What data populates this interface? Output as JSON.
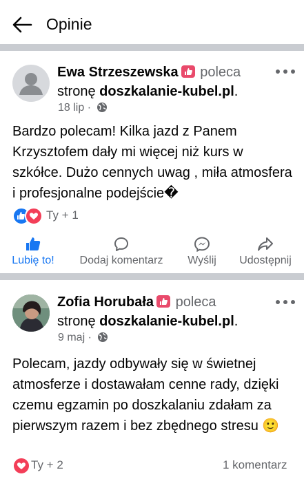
{
  "header": {
    "title": "Opinie"
  },
  "posts": [
    {
      "author": "Ewa Strzeszewska",
      "recommends_text": "poleca",
      "page_prefix": "stronę",
      "page_name": "doszkalanie-kubel.pl",
      "page_suffix": ".",
      "date": "18 lip",
      "date_sep": "·",
      "body": "Bardzo polecam! Kilka jazd z Panem Krzysztofem dały mi więcej niż kurs w szkółce. Dużo cennych uwag , miła atmosfera i profesjonalne podejście�",
      "reactions_text": "Ty + 1",
      "reactions": [
        "like-icon",
        "love-icon"
      ]
    },
    {
      "author": "Zofia Horubała",
      "recommends_text": "poleca",
      "page_prefix": "stronę",
      "page_name": "doszkalanie-kubel.pl",
      "page_suffix": ".",
      "date": "9 maj",
      "date_sep": "·",
      "body": "Polecam, jazdy odbywały się w świetnej atmosferze i dostawałam cenne rady, dzięki czemu egzamin po doszkalaniu zdałam za pierwszym razem i bez zbędnego stresu 🙂",
      "reactions_text": "Ty + 2",
      "reactions": [
        "love-icon"
      ],
      "comments": "1 komentarz"
    }
  ],
  "actions": {
    "like": "Lubię to!",
    "comment": "Dodaj komentarz",
    "send": "Wyślij",
    "share": "Udostępnij"
  },
  "colors": {
    "accent": "#1877f2",
    "love": "#f33e58",
    "recommend": "#e94a6b",
    "separator": "#c9ccd1",
    "meta": "#65676b"
  }
}
